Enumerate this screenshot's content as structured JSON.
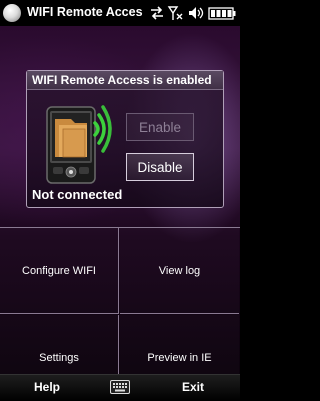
{
  "statusbar": {
    "title": "WIFI Remote Acces",
    "icons": [
      "start-icon",
      "data-sync-icon",
      "no-signal-icon",
      "volume-icon",
      "battery-icon"
    ]
  },
  "panel": {
    "title": "WIFI Remote Access is enabled",
    "status": "Not connected",
    "enable_label": "Enable",
    "disable_label": "Disable",
    "icon": "phone-folder-wifi-icon"
  },
  "grid": {
    "configure_label": "Configure WIFI",
    "viewlog_label": "View log",
    "settings_label": "Settings",
    "preview_label": "Preview in IE"
  },
  "softkeys": {
    "left": "Help",
    "right": "Exit",
    "center_icon": "keyboard-icon"
  },
  "colors": {
    "background": "#2a0a2e",
    "panel_border": "#b0a0b8",
    "wifi_green": "#3cd13c",
    "folder": "#d79a4e"
  }
}
